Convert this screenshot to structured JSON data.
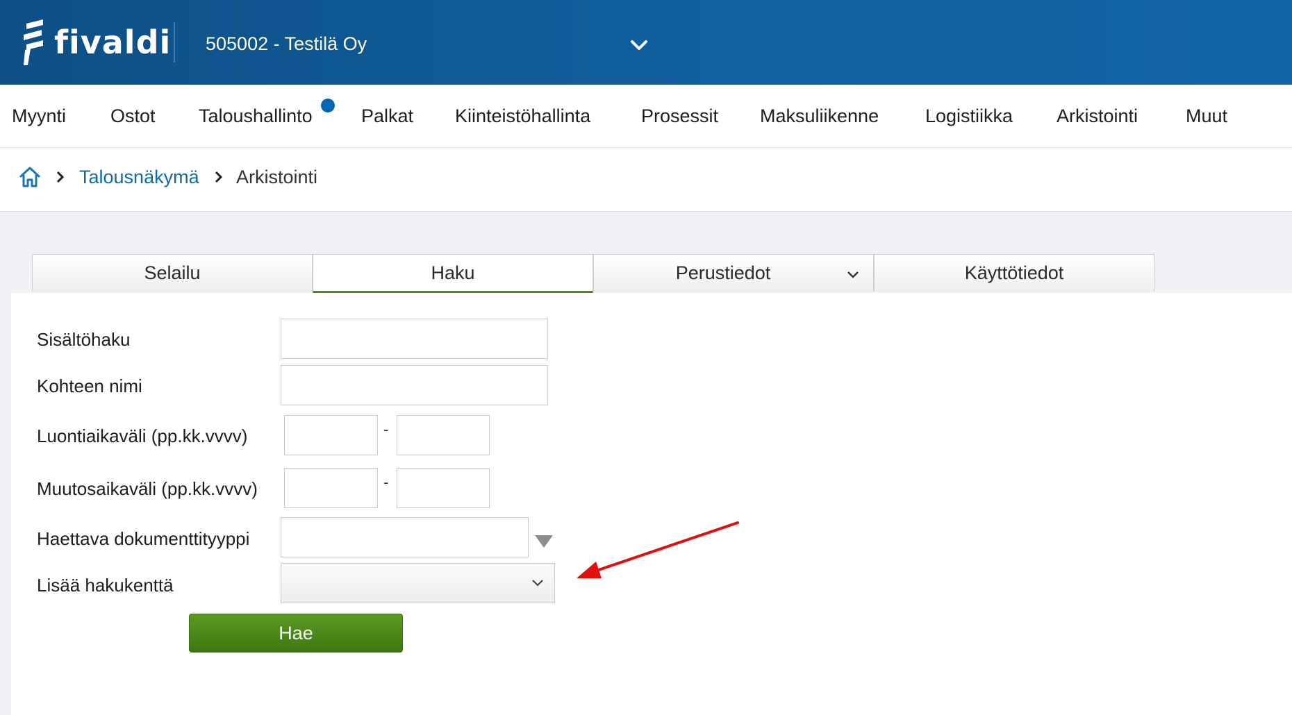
{
  "app": {
    "logo_text": "fivaldi",
    "company": "505002 - Testilä Oy"
  },
  "nav": {
    "items": [
      "Myynti",
      "Ostot",
      "Taloushallinto",
      "Palkat",
      "Kiinteistöhallinta",
      "Prosessit",
      "Maksuliikenne",
      "Logistiikka",
      "Arkistointi",
      "Muut"
    ]
  },
  "breadcrumb": {
    "link": "Talousnäkymä",
    "current": "Arkistointi"
  },
  "tabs": [
    {
      "label": "Selailu"
    },
    {
      "label": "Haku",
      "active": true
    },
    {
      "label": "Perustiedot",
      "has_dropdown": true
    },
    {
      "label": "Käyttötiedot"
    }
  ],
  "form": {
    "sisaltohaku": {
      "label": "Sisältöhaku",
      "value": ""
    },
    "kohteen_nimi": {
      "label": "Kohteen nimi",
      "value": ""
    },
    "luontiaikavali": {
      "label": "Luontiaikaväli (pp.kk.vvvv)",
      "from": "",
      "to": "",
      "separator": "-"
    },
    "muutosaikavali": {
      "label": "Muutosaikaväli (pp.kk.vvvv)",
      "from": "",
      "to": "",
      "separator": "-"
    },
    "dokumenttityyppi": {
      "label": "Haettava dokumenttityyppi",
      "value": ""
    },
    "lisaa_hakukentta": {
      "label": "Lisää hakukenttä",
      "selected": ""
    },
    "submit_label": "Hae"
  },
  "colors": {
    "header_blue": "#11609f",
    "accent_green": "#4b8b1c",
    "link_blue": "#0e6aa8",
    "annotation_red": "#e01010"
  }
}
